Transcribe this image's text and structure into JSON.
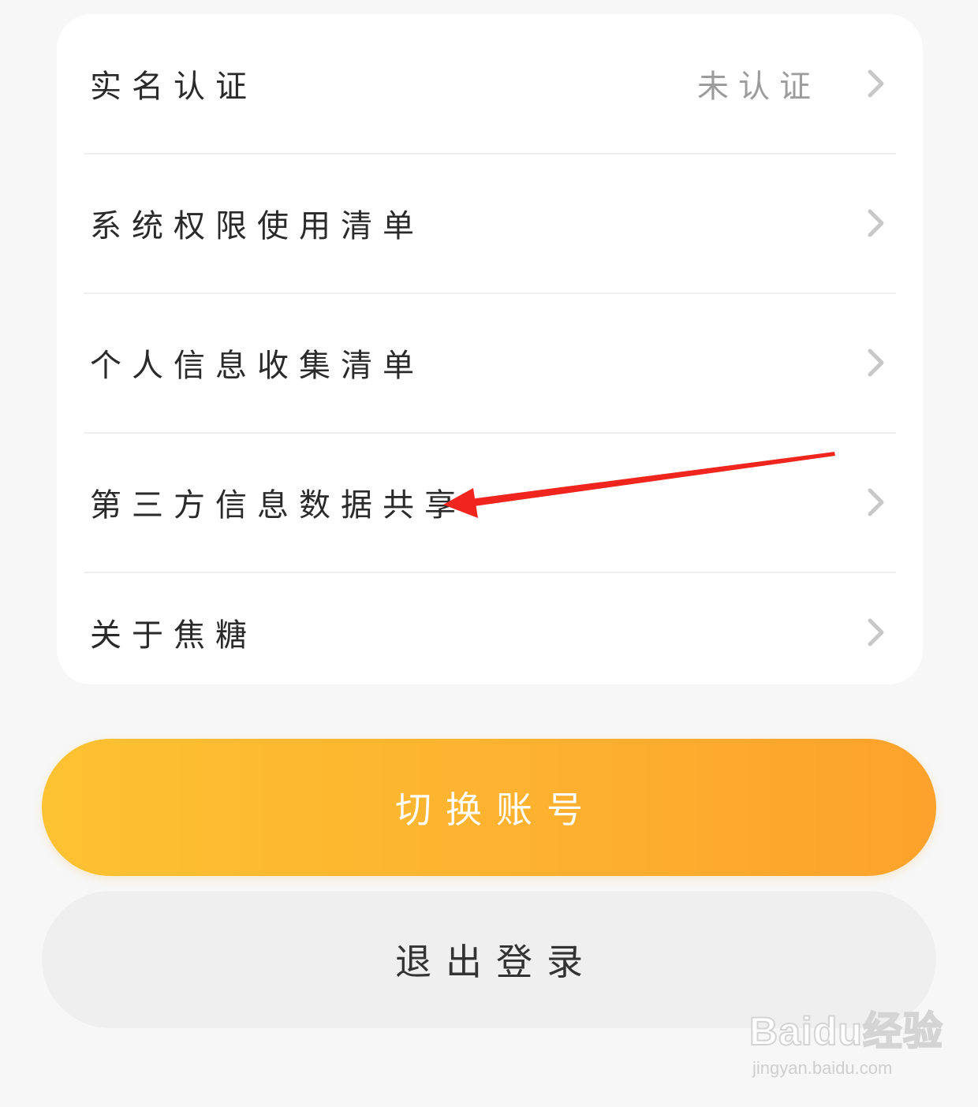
{
  "settings": {
    "items": [
      {
        "label": "实名认证",
        "value": "未认证"
      },
      {
        "label": "系统权限使用清单"
      },
      {
        "label": "个人信息收集清单"
      },
      {
        "label": "第三方信息数据共享"
      },
      {
        "label": "关于焦糖"
      }
    ]
  },
  "actions": {
    "switch_account": "切换账号",
    "logout": "退出登录"
  },
  "icons": {
    "row_chevron": "chevron-right-icon",
    "annotation": "red-arrow-icon"
  },
  "colors": {
    "primary_gradient_start": "#fdc232",
    "primary_gradient_end": "#fda22c",
    "annotation_arrow": "#f0261e",
    "logout_bg": "#efefef"
  },
  "watermark": {
    "logo": "Baidu经验",
    "url": "jingyan.baidu.com"
  }
}
